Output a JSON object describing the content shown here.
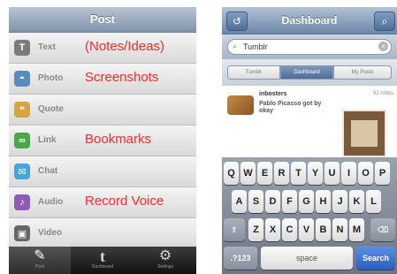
{
  "left": {
    "title": "Post",
    "items": [
      {
        "label": "Text",
        "icon": "text-icon",
        "icon_glyph": "T",
        "color": "#7b7b7b",
        "note": "(Notes/Ideas)"
      },
      {
        "label": "Photo",
        "icon": "photo-icon",
        "icon_glyph": "◓",
        "color": "#5a8bbf",
        "note": "Screenshots"
      },
      {
        "label": "Quote",
        "icon": "quote-icon",
        "icon_glyph": "❝",
        "color": "#d6a442",
        "note": ""
      },
      {
        "label": "Link",
        "icon": "link-icon",
        "icon_glyph": "∞",
        "color": "#4aa84a",
        "note": "Bookmarks"
      },
      {
        "label": "Chat",
        "icon": "chat-icon",
        "icon_glyph": "✉",
        "color": "#4ba3d8",
        "note": ""
      },
      {
        "label": "Audio",
        "icon": "audio-icon",
        "icon_glyph": "♪",
        "color": "#8f5bb5",
        "note": "Record Voice"
      },
      {
        "label": "Video",
        "icon": "video-icon",
        "icon_glyph": "▣",
        "color": "#666666",
        "note": ""
      }
    ],
    "tabs": [
      {
        "icon": "pin-icon",
        "glyph": "✎",
        "label": "Post"
      },
      {
        "icon": "tumblr-icon",
        "glyph": "t",
        "label": "Dashboard"
      },
      {
        "icon": "settings-icon",
        "glyph": "⚙",
        "label": "Settings"
      }
    ]
  },
  "right": {
    "title": "Dashboard",
    "back_glyph": "↺",
    "search_glyph": "⌕",
    "search_value": "Tumblr",
    "segments": [
      "Tumblr",
      "Dashboard",
      "My Posts"
    ],
    "active_segment": "Dashboard",
    "post": {
      "user": "inbosters",
      "count": "52 notes",
      "description": "Pablo Picasso got by okay"
    },
    "keyboard": {
      "row1": [
        "Q",
        "W",
        "E",
        "R",
        "T",
        "Y",
        "U",
        "I",
        "O",
        "P"
      ],
      "row2": [
        "A",
        "S",
        "D",
        "F",
        "G",
        "H",
        "J",
        "K",
        "L"
      ],
      "row3": [
        "Z",
        "X",
        "C",
        "V",
        "B",
        "N",
        "M"
      ],
      "shift": "⇧",
      "delete": "⌫",
      "numbers": ".?123",
      "space": "space",
      "search": "Search"
    }
  }
}
